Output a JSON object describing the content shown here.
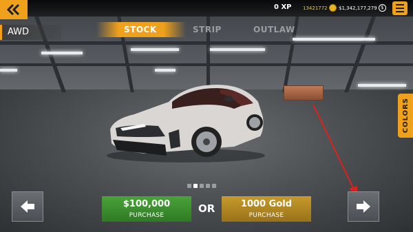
{
  "header": {
    "xp": "0 XP",
    "gold": "13421772",
    "money": "$1,342,177,279",
    "money_symbol": "$"
  },
  "car": {
    "drivetrain": "AWD"
  },
  "tabs": [
    {
      "label": "STOCK",
      "active": true
    },
    {
      "label": "STRIP",
      "active": false
    },
    {
      "label": "OUTLAW",
      "active": false
    }
  ],
  "colors_tab": {
    "label": "COLORS"
  },
  "pager": {
    "total": 5,
    "active_index": 1
  },
  "purchase": {
    "cash_price": "$100,000",
    "cash_action": "PURCHASE",
    "or_label": "OR",
    "gold_price": "1000 Gold",
    "gold_action": "PURCHASE"
  },
  "icons": {
    "back": "double-chevron-left-icon",
    "menu": "hamburger-menu-icon",
    "prev": "arrow-left-icon",
    "next": "arrow-right-icon",
    "gold": "gold-coin-icon",
    "money": "dollar-coin-icon"
  },
  "colors": {
    "accent": "#f0a11b",
    "cash_button": "#3b8f2e",
    "gold_button": "#b08522",
    "annotation": "#e0201b"
  }
}
